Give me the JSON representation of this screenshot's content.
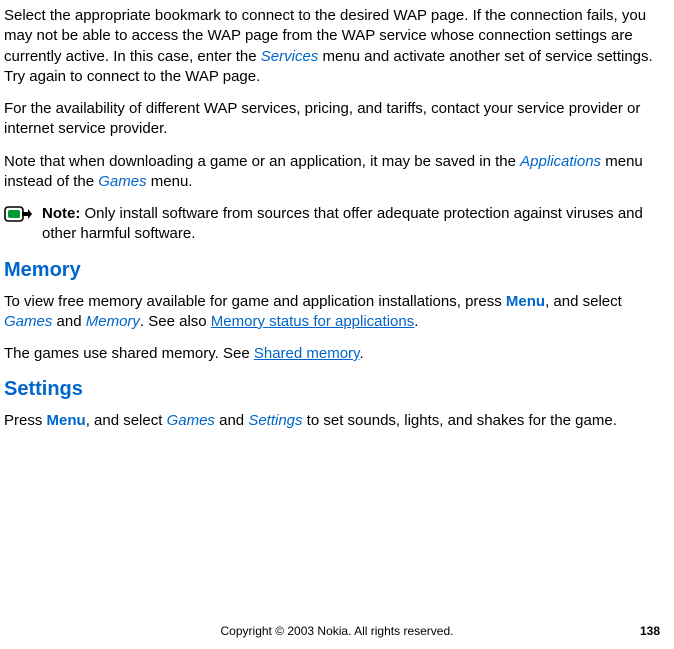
{
  "para1_a": "Select the appropriate bookmark to connect to the desired WAP page. If the connection fails, you may not be able to access the WAP page from the WAP service whose connection settings are currently active. In this case, enter the ",
  "para1_link": "Services",
  "para1_b": " menu and activate another set of service settings. Try again to connect to the WAP page.",
  "para2": "For the availability of different WAP services, pricing, and tariffs, contact your service provider or internet service provider.",
  "para3_a": "Note that when downloading a game or an application, it may be saved in the ",
  "para3_link1": "Applications",
  "para3_b": " menu instead of the ",
  "para3_link2": "Games",
  "para3_c": " menu.",
  "note_label": "Note:",
  "note_text": " Only install software from sources that offer adequate protection against viruses and other harmful software.",
  "heading_memory": "Memory",
  "mem_a": "To view free memory available for game and application installations, press ",
  "mem_menu": "Menu",
  "mem_b": ", and select ",
  "mem_games": "Games",
  "mem_c": " and ",
  "mem_memory": "Memory",
  "mem_d": ". See also ",
  "mem_link": "Memory status for applications",
  "mem_e": ".",
  "shared_a": "The games use shared memory. See ",
  "shared_link": "Shared memory",
  "shared_b": ".",
  "heading_settings": "Settings",
  "set_a": "Press ",
  "set_menu": "Menu",
  "set_b": ", and select ",
  "set_games": "Games",
  "set_c": " and ",
  "set_settings": "Settings",
  "set_d": " to set sounds, lights, and shakes for the game.",
  "copyright": "Copyright © 2003 Nokia. All rights reserved.",
  "page_number": "138"
}
